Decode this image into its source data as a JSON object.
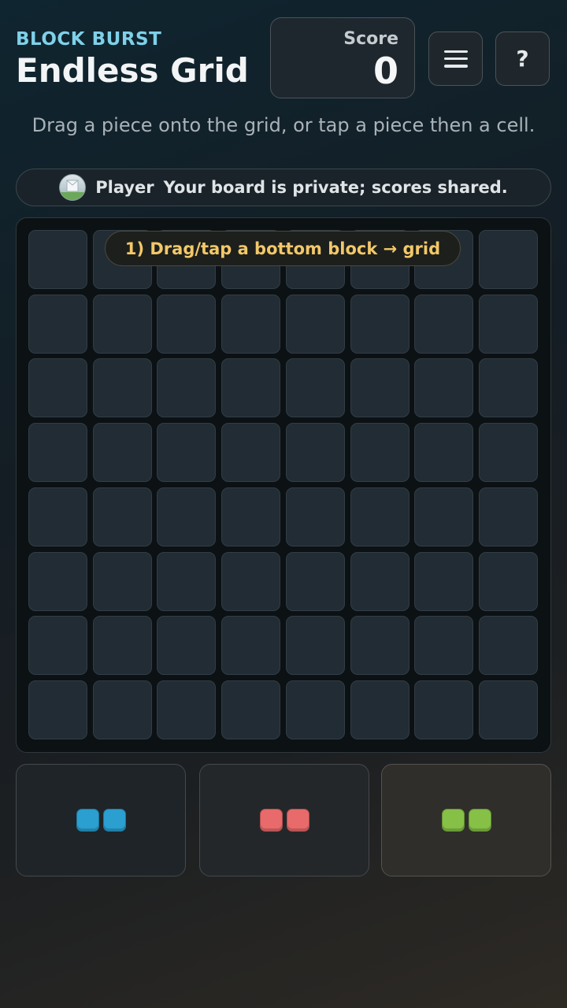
{
  "header": {
    "brand_sub": "BLOCK BURST",
    "brand_title": "Endless Grid",
    "score_label": "Score",
    "score_value": "0"
  },
  "buttons": {
    "menu_icon": "hamburger-icon",
    "help_label": "?"
  },
  "instructions": "Drag a piece onto the grid, or tap a piece then a cell.",
  "player": {
    "name": "Player",
    "note": "Your board is private; scores shared."
  },
  "hint": "1) Drag/tap a bottom block → grid",
  "board": {
    "rows": 8,
    "cols": 8
  },
  "pieces": [
    {
      "color": "#2a9fd0",
      "blocks": 2
    },
    {
      "color": "#e86a6a",
      "blocks": 2
    },
    {
      "color": "#86c046",
      "blocks": 2
    }
  ]
}
